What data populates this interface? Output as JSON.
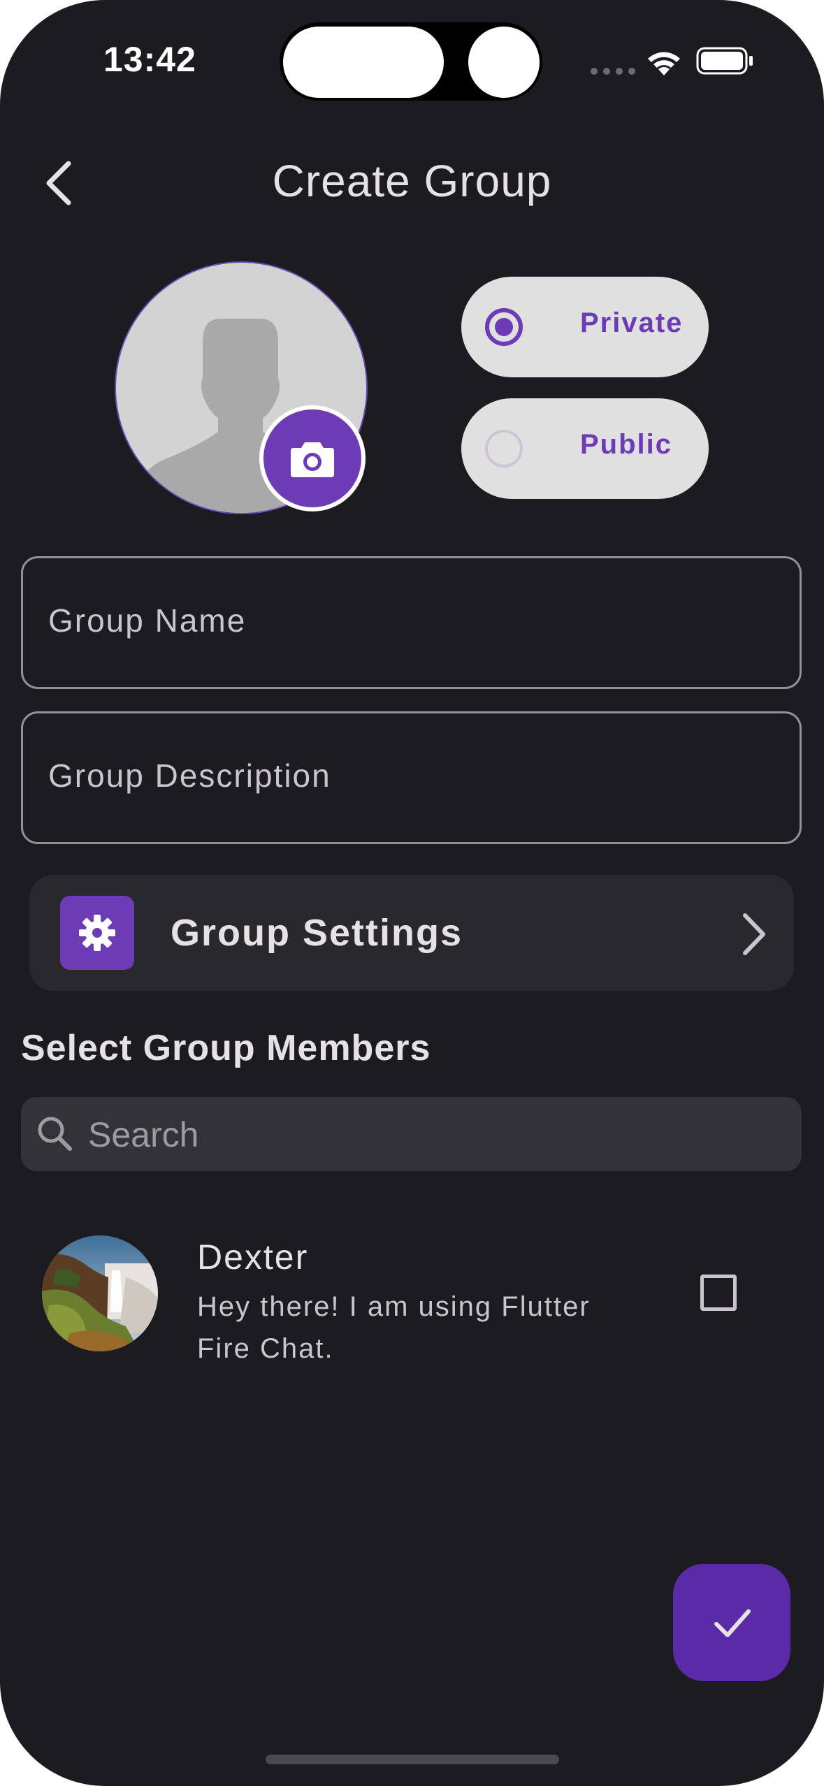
{
  "status_bar": {
    "time": "13:42",
    "wifi_icon": "wifi-icon",
    "battery_icon": "battery-icon"
  },
  "header": {
    "title": "Create Group",
    "back_icon": "chevron-left-icon"
  },
  "avatar": {
    "placeholder_icon": "person-silhouette-icon",
    "camera_icon": "camera-icon"
  },
  "privacy": {
    "options": [
      {
        "label": "Private",
        "selected": true
      },
      {
        "label": "Public",
        "selected": false
      }
    ]
  },
  "form": {
    "group_name_placeholder": "Group Name",
    "group_description_placeholder": "Group Description"
  },
  "settings": {
    "label": "Group Settings",
    "icon": "gear-icon",
    "chevron": "chevron-right-icon"
  },
  "members": {
    "section_title": "Select Group Members",
    "search_placeholder": "Search",
    "list": [
      {
        "name": "Dexter",
        "status": "Hey there! I am using Flutter Fire Chat.",
        "checked": false
      }
    ]
  },
  "fab": {
    "icon": "check-icon"
  },
  "colors": {
    "background": "#1c1b1f",
    "accent": "#6c3bb5",
    "chip_background": "#e0e0e0",
    "tile_background": "#29282d"
  }
}
